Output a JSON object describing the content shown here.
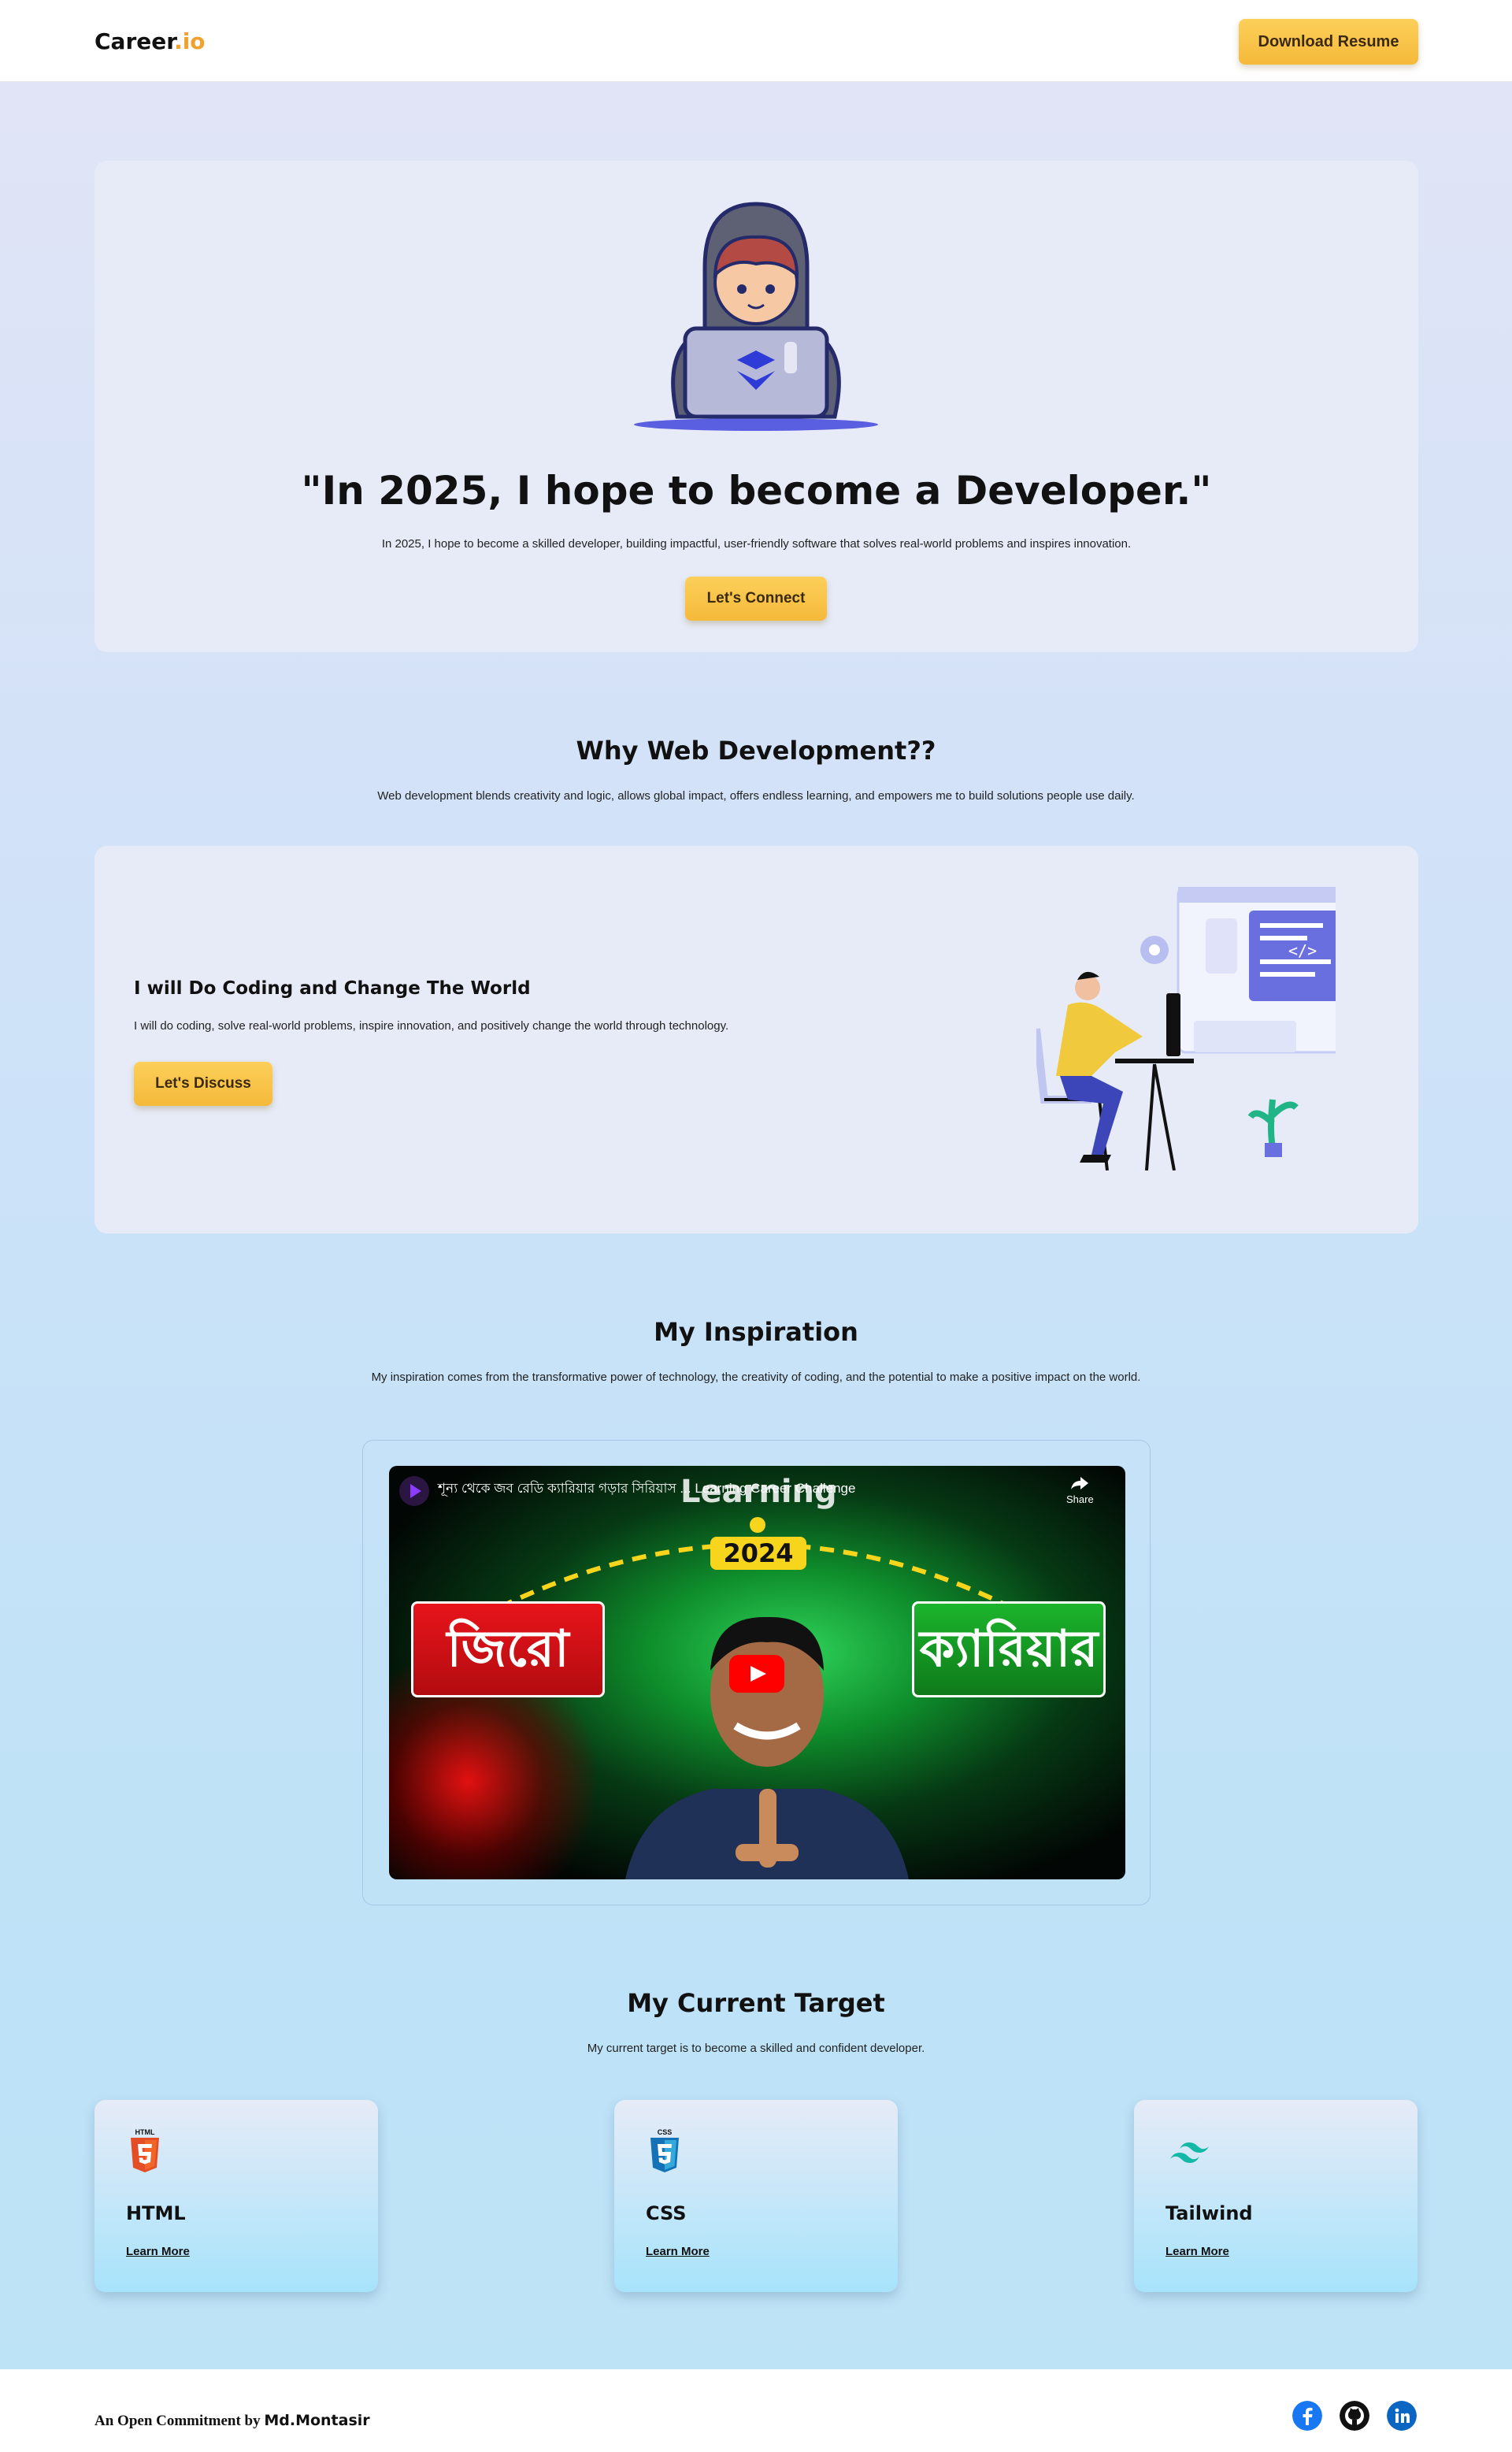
{
  "header": {
    "logo_main": "Career",
    "logo_accent": ".io",
    "download_label": "Download Resume"
  },
  "hero": {
    "title": "\"In 2025, I hope to become a Developer.\"",
    "subtitle": "In 2025, I hope to become a skilled developer, building impactful, user-friendly software that solves real-world problems and inspires innovation.",
    "cta_label": "Let's Connect"
  },
  "why": {
    "title": "Why Web Development??",
    "subtitle": "Web development blends creativity and logic, allows global impact, offers endless learning, and empowers me to build solutions people use daily.",
    "card": {
      "title": "I will Do Coding and Change The World",
      "text": "I will do coding, solve real-world problems, inspire innovation, and positively change the world through technology.",
      "cta_label": "Let's Discuss"
    }
  },
  "inspiration": {
    "title": "My Inspiration",
    "subtitle": "My inspiration comes from the transformative power of technology, the creativity of coding, and the potential to make a positive impact on the world.",
    "video": {
      "title": "শূন্য থেকে জব রেডি ক্যারিয়ার গড়ার সিরিয়াস ... Learning Career Challenge",
      "overlay_top": "Learning",
      "year": "2024",
      "left_badge": "জিরো",
      "right_badge": "ক্যারিয়ার",
      "share_label": "Share"
    }
  },
  "target": {
    "title": "My Current Target",
    "subtitle": "My current target is to become a skilled and confident developer.",
    "cards": [
      {
        "name": "HTML",
        "icon_text": "HTML",
        "link": "Learn More"
      },
      {
        "name": "CSS",
        "icon_text": "CSS",
        "link": "Learn More"
      },
      {
        "name": "Tailwind",
        "link": "Learn More"
      }
    ]
  },
  "footer": {
    "commit_prefix": "An Open Commitment by",
    "author": "Md.Montasir"
  },
  "colors": {
    "accent_yellow": "#f5b93a",
    "logo_accent": "#f0a22c",
    "card_bg": "#e6ebf7"
  }
}
